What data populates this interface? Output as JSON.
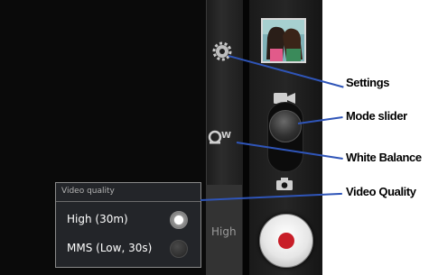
{
  "video_quality_popup": {
    "title": "Video quality",
    "options": [
      {
        "label": "High (30m)",
        "selected": true
      },
      {
        "label": "MMS (Low, 30s)",
        "selected": false
      }
    ]
  },
  "controls": {
    "white_balance_text": "W",
    "current_quality_label": "High",
    "settings_icon": "gear-icon",
    "video_mode_icon": "video-camera-icon",
    "camera_mode_icon": "camera-icon",
    "record_button_color": "#c81e28"
  },
  "callouts": {
    "settings": "Settings",
    "mode_slider": "Mode slider",
    "white_balance": "White Balance",
    "video_quality": "Video Quality"
  },
  "colors": {
    "callout_line": "#2f55b8"
  }
}
